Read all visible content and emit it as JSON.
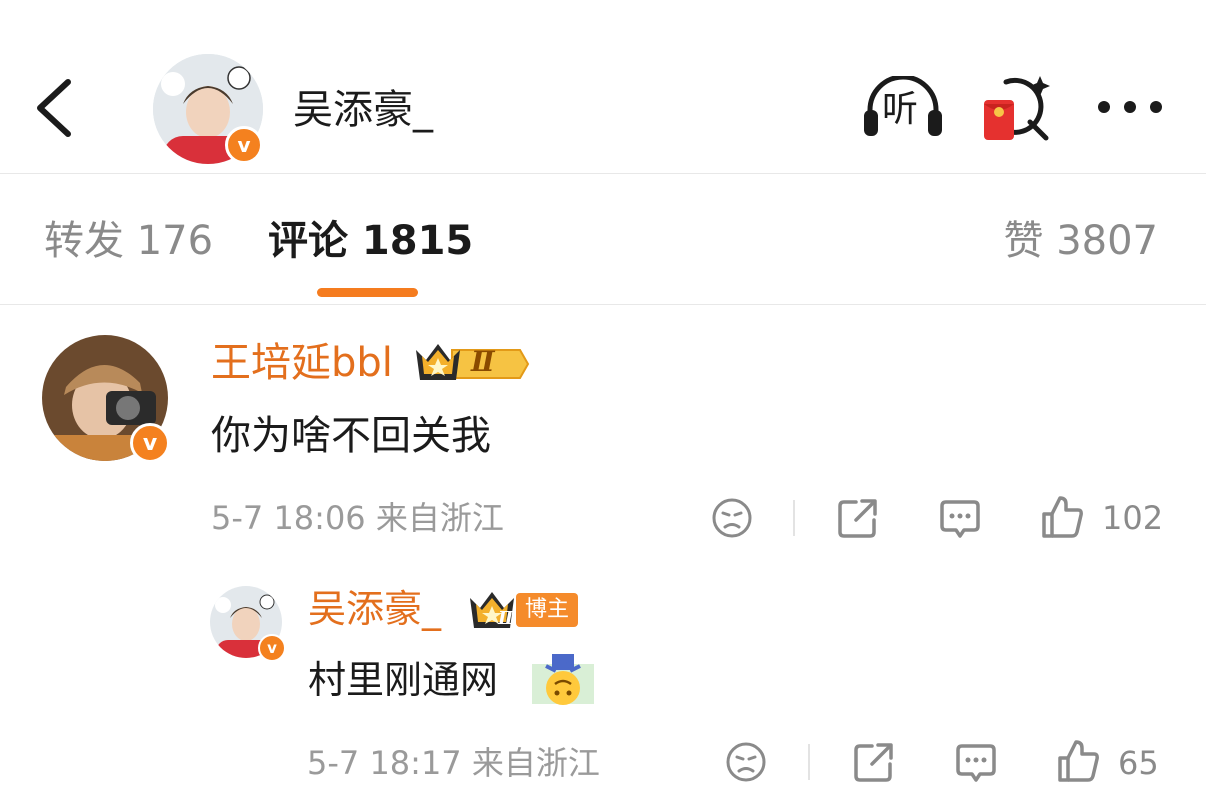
{
  "header": {
    "back_icon": "chevron-left-icon",
    "author_name": "吴添豪_",
    "listen_label": "听",
    "icons": [
      "headphones-icon",
      "red-packet-icon",
      "more-icon"
    ]
  },
  "tabs": [
    {
      "label": "转发 176",
      "active": false
    },
    {
      "label": "评论 1815",
      "active": true
    },
    {
      "label": "赞 3807",
      "active": false
    }
  ],
  "colors": {
    "accent": "#f57c1f",
    "username": "#e36f1d",
    "meta": "#9a9a9a",
    "verified": "#f4811f"
  },
  "comments": [
    {
      "username": "王培延bbl",
      "level_badge": "Ⅱ",
      "text": "你为啥不回关我",
      "time": "5-7 18:06",
      "location": "来自浙江",
      "like_count": "102",
      "verified_mark": "v"
    }
  ],
  "reply": {
    "username": "吴添豪_",
    "tag": "博主",
    "level_badge": "Ⅱ",
    "text": "村里刚通网",
    "emoji": "upside-down-face-emoji",
    "time": "5-7 18:17",
    "location": "来自浙江",
    "like_count": "65",
    "verified_mark": "v"
  }
}
